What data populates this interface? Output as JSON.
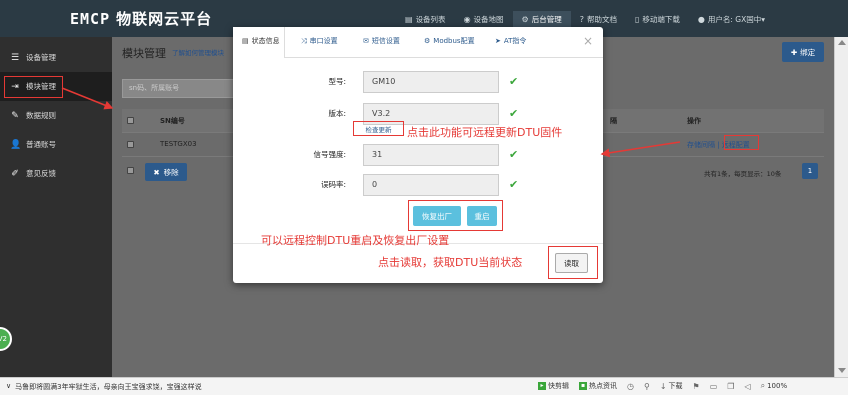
{
  "topbar": {
    "brand": "EMCP",
    "title": "物联网云平台",
    "nav": [
      {
        "label": "设备列表",
        "icon": "list-icon"
      },
      {
        "label": "设备地图",
        "icon": "map-pin-icon"
      },
      {
        "label": "后台管理",
        "icon": "gears-icon"
      },
      {
        "label": "帮助文档",
        "icon": "help-icon"
      },
      {
        "label": "移动端下载",
        "icon": "mobile-icon"
      },
      {
        "label": "用户名: GX国中▾",
        "icon": "user-icon"
      }
    ]
  },
  "sidebar": {
    "items": [
      {
        "label": "设备管理",
        "icon": "list-icon"
      },
      {
        "label": "模块管理",
        "icon": "login-icon"
      },
      {
        "label": "数据规则",
        "icon": "pencil-icon"
      },
      {
        "label": "普通账号",
        "icon": "user-icon"
      },
      {
        "label": "意见反馈",
        "icon": "edit-icon"
      }
    ],
    "badge": "V2"
  },
  "main": {
    "title": "模块管理",
    "help_link": "了解如何管理模块",
    "bind_label": "绑定",
    "search_placeholder": "sn码、所属账号",
    "table": {
      "headers": [
        "SN编号",
        "隔",
        "操作"
      ],
      "rows": [
        {
          "sn": "TESTGX03",
          "ops": "存储间隔 | 远程配置"
        }
      ]
    },
    "remove_label": "移除",
    "pager_text": "共有1条，每页显示：10条",
    "pager_page": "1"
  },
  "modal": {
    "tabs": [
      {
        "label": "状态信息",
        "icon": "info-icon"
      },
      {
        "label": "串口设置",
        "icon": "shuffle-icon"
      },
      {
        "label": "短信设置",
        "icon": "envelope-icon"
      },
      {
        "label": "Modbus配置",
        "icon": "gear-icon"
      },
      {
        "label": "AT指令",
        "icon": "send-icon"
      }
    ],
    "close": "×",
    "fields": [
      {
        "label": "型号:",
        "value": "GM10"
      },
      {
        "label": "版本:",
        "value": "V3.2"
      },
      {
        "label": "信号强度:",
        "value": "31"
      },
      {
        "label": "误码率:",
        "value": "0"
      }
    ],
    "check_update": "检查更新",
    "factory_reset": "恢复出厂",
    "restart": "重启",
    "read": "读取"
  },
  "annotations": {
    "update": "点击此功能可远程更新DTU固件",
    "reboot": "可以远程控制DTU重启及恢复出厂设置",
    "read": "点击读取，获取DTU当前状态"
  },
  "statusbar": {
    "news": "马鲁即将圆满3年牢狱生活，母亲向王宝强求饶，宝强这样说",
    "items": [
      "快剪辑",
      "热点资讯",
      "下载",
      "100%"
    ]
  }
}
